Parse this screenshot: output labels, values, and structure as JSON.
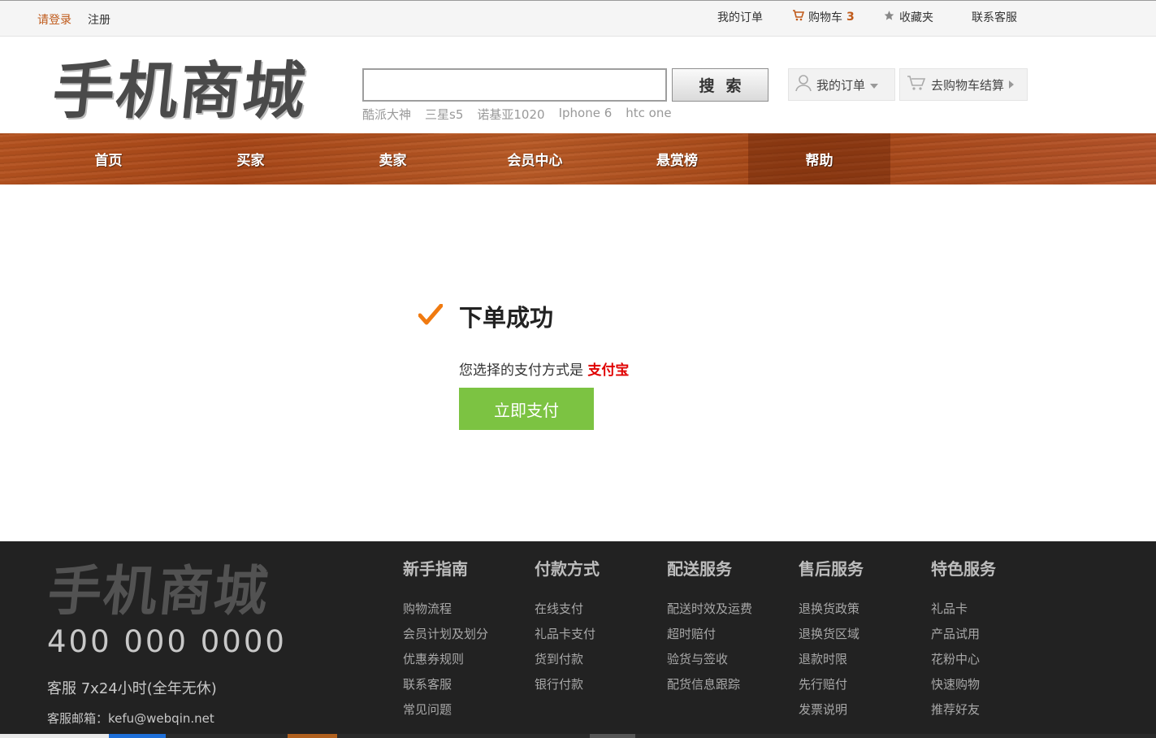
{
  "topbar": {
    "login": "请登录",
    "register": "注册",
    "my_orders": "我的订单",
    "cart_label": "购物车",
    "cart_count": "3",
    "favorites": "收藏夹",
    "contact": "联系客服"
  },
  "header": {
    "logo": "手机商城",
    "search_placeholder": "",
    "search_button": "搜索",
    "hot_words": [
      "酷派大神",
      "三星s5",
      "诺基亚1020",
      "Iphone 6",
      "htc one"
    ],
    "my_orders_button": "我的订单",
    "checkout_button": "去购物车结算"
  },
  "nav": {
    "items": [
      "首页",
      "买家",
      "卖家",
      "会员中心",
      "悬赏榜",
      "帮助"
    ],
    "active": "帮助"
  },
  "main": {
    "title": "下单成功",
    "pay_prefix": "您选择的支付方式是",
    "pay_method": "支付宝",
    "pay_button": "立即支付"
  },
  "footer": {
    "logo": "手机商城",
    "phone": "400 000 0000",
    "service_hours": "客服 7x24小时(全年无休)",
    "email": "客服邮箱：kefu@webqin.net",
    "columns": [
      {
        "title": "新手指南",
        "links": [
          "购物流程",
          "会员计划及划分",
          "优惠券规则",
          "联系客服",
          "常见问题"
        ]
      },
      {
        "title": "付款方式",
        "links": [
          "在线支付",
          "礼品卡支付",
          "货到付款",
          "银行付款"
        ]
      },
      {
        "title": "配送服务",
        "links": [
          "配送时效及运费",
          "超时赔付",
          "验货与签收",
          "配货信息跟踪"
        ]
      },
      {
        "title": "售后服务",
        "links": [
          "退换货政策",
          "退换货区域",
          "退款时限",
          "先行赔付",
          "发票说明"
        ]
      },
      {
        "title": "特色服务",
        "links": [
          "礼品卡",
          "产品试用",
          "花粉中心",
          "快速购物",
          "推荐好友"
        ]
      }
    ]
  },
  "colors": {
    "accent_orange": "#c05a1a",
    "pay_green": "#7cc342",
    "pay_method_red": "#e00000",
    "footer_bg": "#222222"
  }
}
